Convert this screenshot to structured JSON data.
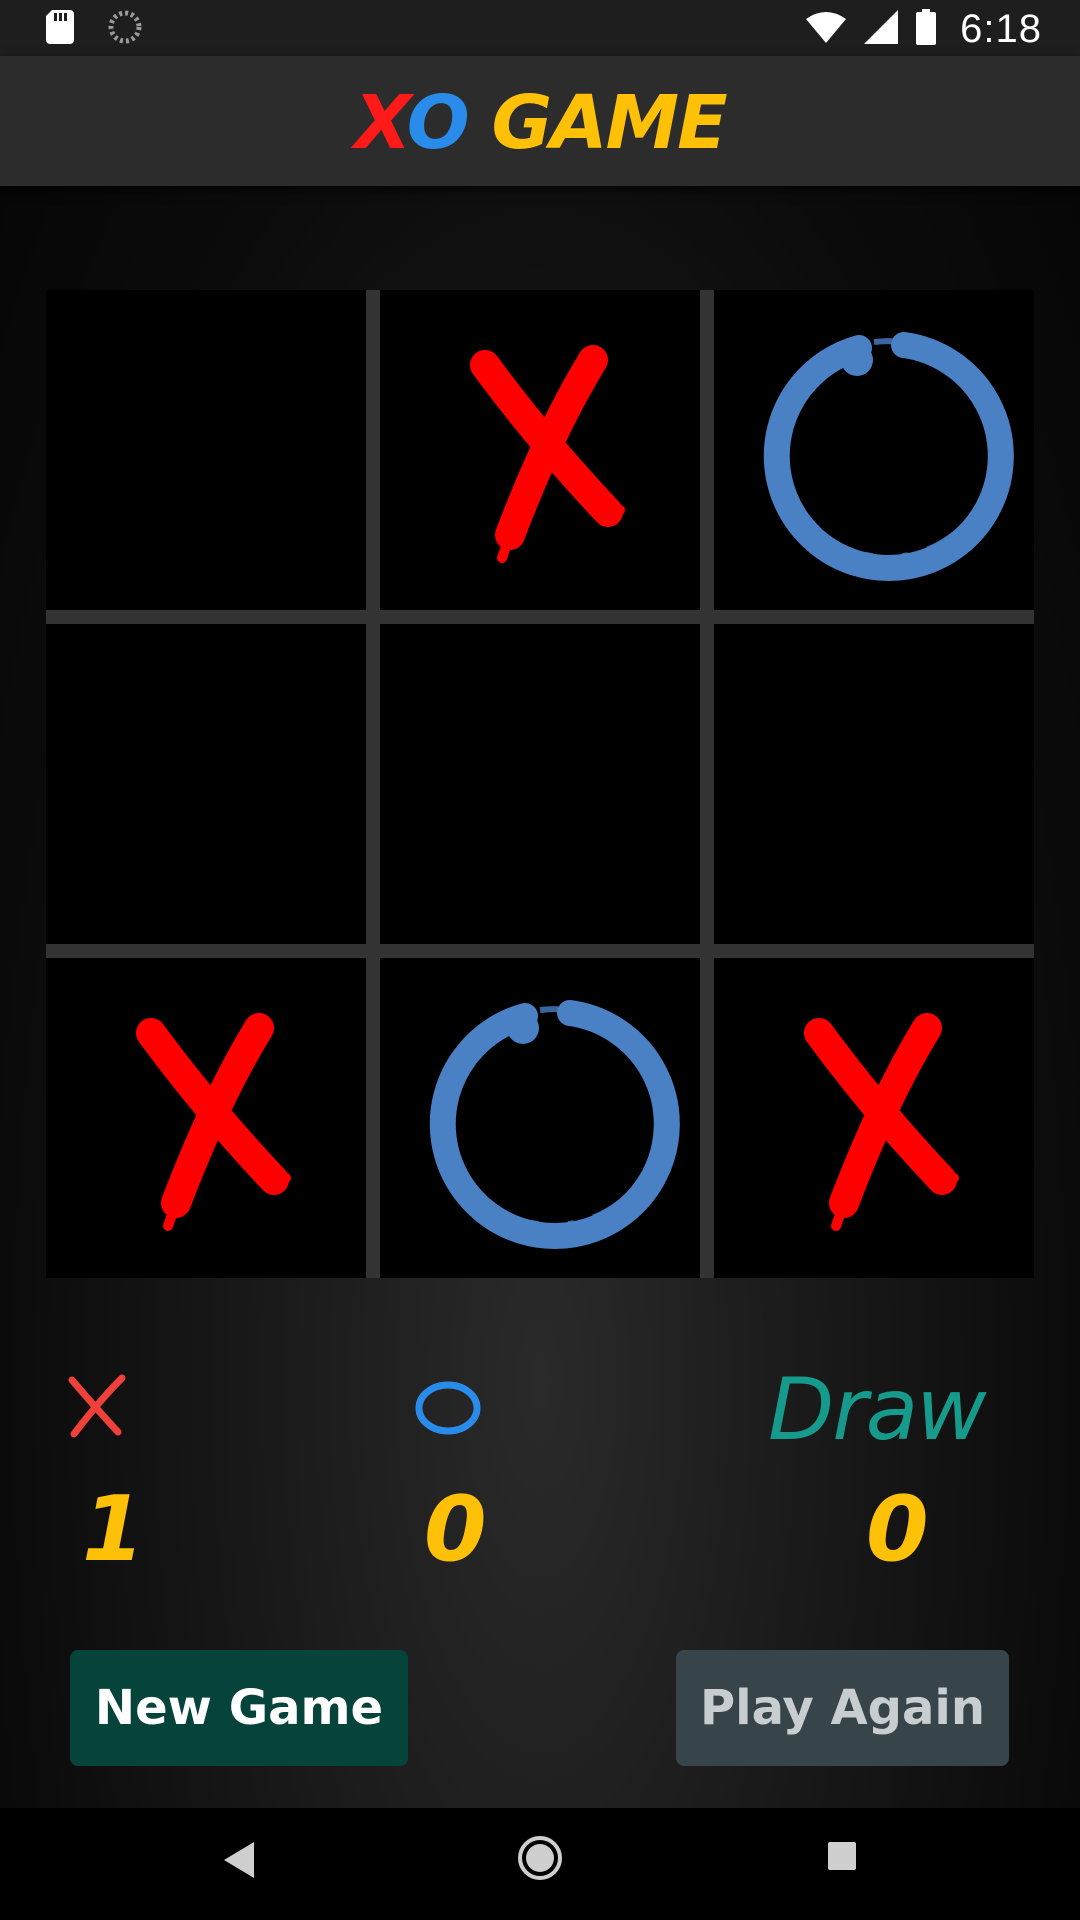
{
  "status_bar": {
    "time": "6:18",
    "icons": [
      "sd-card-icon",
      "loading-icon",
      "wifi-icon",
      "signal-icon",
      "battery-icon"
    ]
  },
  "app": {
    "title_x": "X",
    "title_o": "O",
    "title_rest": " GAME"
  },
  "board": {
    "cells": [
      "",
      "X",
      "O",
      "",
      "",
      "",
      "X",
      "O",
      "X"
    ]
  },
  "scores": {
    "x_label": "X",
    "o_label": "O",
    "draw_label": "Draw",
    "x_score": "1",
    "o_score": "0",
    "draw_score": "0"
  },
  "buttons": {
    "new_game": "New Game",
    "play_again": "Play Again"
  },
  "nav": {
    "icons": [
      "back-icon",
      "home-icon",
      "recents-icon"
    ]
  },
  "colors": {
    "x_mark": "#ff0000",
    "o_mark": "#4a80c4",
    "score": "#ffc107",
    "draw": "#159a8c",
    "new_game_bg": "#06433a",
    "play_again_bg": "#37454a"
  }
}
